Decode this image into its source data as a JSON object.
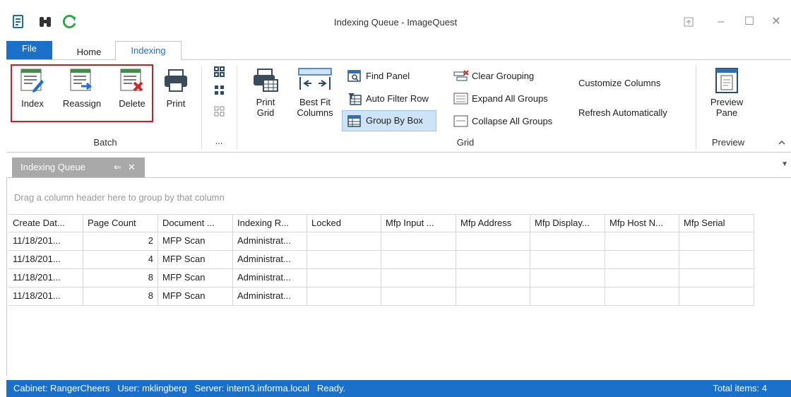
{
  "window": {
    "title": "Indexing Queue - ImageQuest"
  },
  "ribbon_tabs": {
    "file": "File",
    "home": "Home",
    "indexing": "Indexing"
  },
  "ribbon": {
    "batch": {
      "index": "Index",
      "reassign": "Reassign",
      "delete": "Delete",
      "print": "Print",
      "group_label": "Batch"
    },
    "overflow_label": "...",
    "grid": {
      "print_grid": [
        "Print",
        "Grid"
      ],
      "best_fit": [
        "Best Fit",
        "Columns"
      ],
      "find_panel": "Find Panel",
      "auto_filter_row": "Auto Filter Row",
      "group_by_box": "Group By Box",
      "clear_grouping": "Clear Grouping",
      "expand_all_groups": "Expand All Groups",
      "collapse_all_groups": "Collapse All Groups",
      "customize_columns": "Customize Columns",
      "refresh_automatically": "Refresh Automatically",
      "group_label": "Grid"
    },
    "preview": {
      "preview_pane": [
        "Preview",
        "Pane"
      ],
      "group_label": "Preview"
    }
  },
  "document_tab": {
    "label": "Indexing Queue"
  },
  "group_panel_hint": "Drag a column header here to group by that column",
  "table": {
    "headers": [
      "Create Dat...",
      "Page Count",
      "Document ...",
      "Indexing R...",
      "Locked",
      "Mfp Input ...",
      "Mfp Address",
      "Mfp Display...",
      "Mfp Host N...",
      "Mfp Serial"
    ],
    "rows": [
      [
        "11/18/201...",
        "2",
        "MFP Scan",
        "Administrat...",
        "",
        "",
        "",
        "",
        "",
        ""
      ],
      [
        "11/18/201...",
        "4",
        "MFP Scan",
        "Administrat...",
        "",
        "",
        "",
        "",
        "",
        ""
      ],
      [
        "11/18/201...",
        "8",
        "MFP Scan",
        "Administrat...",
        "",
        "",
        "",
        "",
        "",
        ""
      ],
      [
        "11/18/201...",
        "8",
        "MFP Scan",
        "Administrat...",
        "",
        "",
        "",
        "",
        "",
        ""
      ]
    ]
  },
  "statusbar": {
    "left": "Cabinet: RangerCheers   User: mklingberg   Server: intern3.informa.local   Ready.",
    "right": "Total items: 4"
  },
  "colors": {
    "accent": "#1a6fc9",
    "highlight_box": "#c6202c",
    "selected_button": "#cde4f8"
  }
}
